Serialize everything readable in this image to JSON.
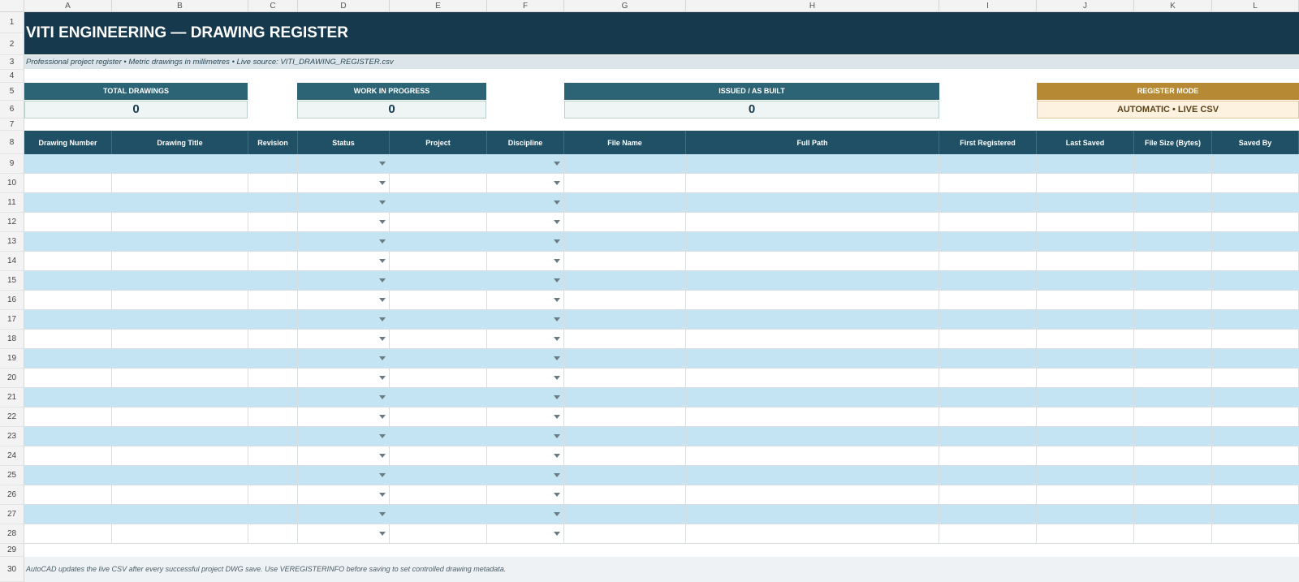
{
  "sheet": {
    "columns": [
      "A",
      "B",
      "C",
      "D",
      "E",
      "F",
      "G",
      "H",
      "I",
      "J",
      "K",
      "L"
    ],
    "row_numbers": [
      "1",
      "2",
      "3",
      "4",
      "5",
      "6",
      "7",
      "8",
      "9",
      "10",
      "11",
      "12",
      "13",
      "14",
      "15",
      "16",
      "17",
      "18",
      "19",
      "20",
      "21",
      "22",
      "23",
      "24",
      "25",
      "26",
      "27",
      "28",
      "29",
      "30"
    ]
  },
  "header": {
    "title": "VITI ENGINEERING — DRAWING REGISTER",
    "subtitle": "Professional project register • Metric drawings in millimetres • Live source: VITI_DRAWING_REGISTER.csv"
  },
  "kpis": {
    "total_label": "TOTAL DRAWINGS",
    "total_value": "0",
    "wip_label": "WORK IN PROGRESS",
    "wip_value": "0",
    "issued_label": "ISSUED / AS BUILT",
    "issued_value": "0",
    "mode_label": "REGISTER MODE",
    "mode_value": "AUTOMATIC • LIVE CSV"
  },
  "table": {
    "headers": [
      "Drawing Number",
      "Drawing Title",
      "Revision",
      "Status",
      "Project",
      "Discipline",
      "File Name",
      "Full Path",
      "First Registered",
      "Last Saved",
      "File Size (Bytes)",
      "Saved By"
    ],
    "dropdown_columns": [
      "Status",
      "Discipline"
    ],
    "row_count": 20
  },
  "footer": {
    "note": "AutoCAD updates the live CSV after every successful project DWG save. Use VEREGISTERINFO before saving to set controlled drawing metadata."
  },
  "colors": {
    "title_bg": "#17394e",
    "kpi_header": "#2c6476",
    "mode_header": "#b68a34",
    "table_header": "#1f5065",
    "band_row": "#c5e4f3"
  }
}
